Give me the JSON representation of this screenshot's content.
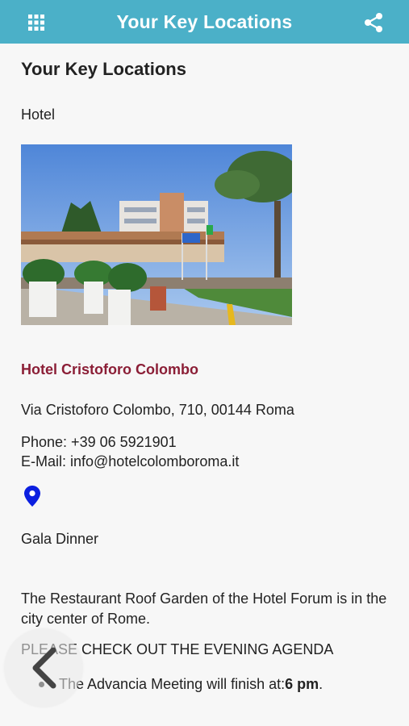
{
  "appbar": {
    "title": "Your Key Locations",
    "menu_icon": "grid-icon",
    "share_icon": "share-icon",
    "color": "#4bb0c8"
  },
  "page": {
    "heading": "Your Key Locations",
    "section_label": "Hotel",
    "hotel": {
      "name": "Hotel Cristoforo Colombo",
      "name_color": "#8b1e36",
      "address": "Via Cristoforo Colombo, 710, 00144 Roma",
      "phone": "Phone: +39 06 5921901",
      "email": "E-Mail: info@hotelcolomboroma.it",
      "map_icon": "location-pin-icon"
    },
    "event_label": "Gala Dinner",
    "description": "The Restaurant Roof Garden of the Hotel Forum is in the city center of Rome.",
    "agenda_heading": "PLEASE CHECK OUT THE EVENING AGENDA",
    "agenda_item_text": "The Advancia Meeting will finish at: ",
    "agenda_item_time": "6 pm",
    "agenda_item_suffix": "."
  },
  "nav": {
    "back_icon": "chevron-left-icon"
  }
}
